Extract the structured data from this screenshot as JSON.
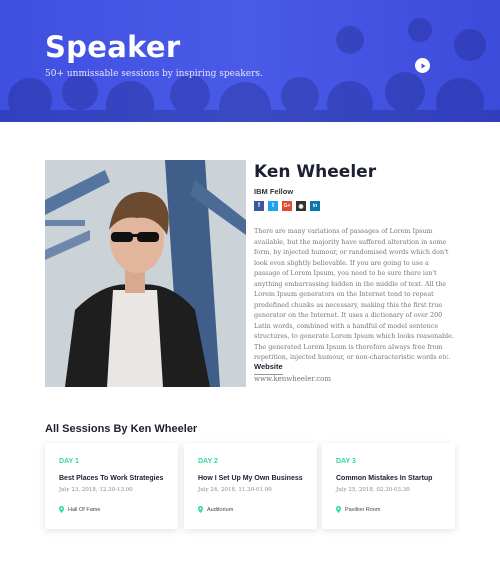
{
  "hero": {
    "title": "Speaker",
    "subtitle": "50+ unmissable sessions by inspiring speakers."
  },
  "speaker": {
    "name": "Ken Wheeler",
    "role": "IBM Fellow",
    "socials": [
      {
        "icon": "facebook-icon",
        "glyph": "f",
        "color": "#3b5998"
      },
      {
        "icon": "twitter-icon",
        "glyph": "t",
        "color": "#1da1f2"
      },
      {
        "icon": "google-plus-icon",
        "glyph": "G+",
        "color": "#dd4b39"
      },
      {
        "icon": "github-icon",
        "glyph": "◉",
        "color": "#333333"
      },
      {
        "icon": "linkedin-icon",
        "glyph": "in",
        "color": "#0e76a8"
      }
    ],
    "bio": "There are many variations of passages of Lorem Ipsum available, but the majority have suffered alteration in some form, by injected humour, or randomised words which don't look even slightly believable. If you are going to use a passage of Lorem Ipsum, you need to be sure there isn't anything embarrassing hidden in the middle of text. All the Lorem Ipsum generators on the Internet tend to repeat predefined chunks as necessary, making this the first true generator on the Internet. It uses a dictionary of over 200 Latin words, combined with a handful of model sentence structures, to generate Lorem Ipsum which looks reasonable. The generated Lorem Ipsum is therefore always free from repetition, injected humour, or non-characteristic words etc.",
    "website_label": "Website",
    "website_url": "www.kenwheeler.com"
  },
  "sessions": {
    "title": "All Sessions By Ken Wheeler",
    "items": [
      {
        "day": "DAY 1",
        "title": "Best Places To Work Strategies",
        "time": "July 23, 2018, 12.30-13.00",
        "location": "Hall Of Fame"
      },
      {
        "day": "DAY 2",
        "title": "How I Set Up My Own Business",
        "time": "July 24, 2018, 11.30-01.00",
        "location": "Auditorium"
      },
      {
        "day": "DAY 3",
        "title": "Common Mistakes In Startup",
        "time": "July 25, 2018, 02.30-03.30",
        "location": "Pavilion Room"
      }
    ]
  },
  "colors": {
    "hero": "#4252e4",
    "accent": "#35d6a2",
    "heading": "#1d1f33"
  }
}
